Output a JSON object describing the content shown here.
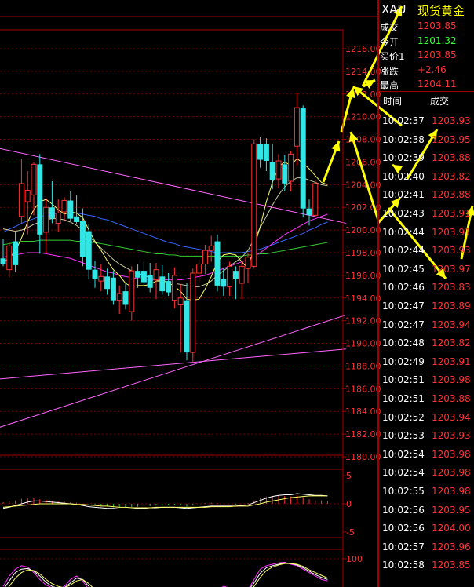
{
  "header": {
    "symbol": "XAU",
    "name": "现货黄金"
  },
  "quote": [
    {
      "label": "成交",
      "value": "1203.85",
      "color": "#ff3333"
    },
    {
      "label": "今开",
      "value": "1201.32",
      "color": "#33ff33"
    },
    {
      "label": "买价1",
      "value": "1203.85",
      "color": "#ff3333"
    },
    {
      "label": "涨跌",
      "value": "+2.46",
      "color": "#ff3333"
    },
    {
      "label": "最高",
      "value": "1204.11",
      "color": "#ff3333"
    }
  ],
  "ticks_header": {
    "time": "时间",
    "price": "成交"
  },
  "ticks": [
    {
      "time": "10:02:37",
      "price": "1203.93"
    },
    {
      "time": "10:02:38",
      "price": "1203.95"
    },
    {
      "time": "10:02:39",
      "price": "1203.88"
    },
    {
      "time": "10:02:40",
      "price": "1203.82"
    },
    {
      "time": "10:02:41",
      "price": "1203.88"
    },
    {
      "time": "10:02:43",
      "price": "1203.91"
    },
    {
      "time": "10:02:44",
      "price": "1203.91"
    },
    {
      "time": "10:02:44",
      "price": "1203.93"
    },
    {
      "time": "10:02:45",
      "price": "1203.97"
    },
    {
      "time": "10:02:46",
      "price": "1203.83"
    },
    {
      "time": "10:02:47",
      "price": "1203.89"
    },
    {
      "time": "10:02:47",
      "price": "1203.94"
    },
    {
      "time": "10:02:48",
      "price": "1203.82"
    },
    {
      "time": "10:02:49",
      "price": "1203.91"
    },
    {
      "time": "10:02:51",
      "price": "1203.98"
    },
    {
      "time": "10:02:51",
      "price": "1203.88"
    },
    {
      "time": "10:02:52",
      "price": "1203.94"
    },
    {
      "time": "10:02:53",
      "price": "1203.93"
    },
    {
      "time": "10:02:54",
      "price": "1203.98"
    },
    {
      "time": "10:02:54",
      "price": "1203.98"
    },
    {
      "time": "10:02:55",
      "price": "1203.98"
    },
    {
      "time": "10:02:56",
      "price": "1203.95"
    },
    {
      "time": "10:02:56",
      "price": "1204.00"
    },
    {
      "time": "10:02:57",
      "price": "1203.96"
    },
    {
      "time": "10:02:58",
      "price": "1203.85"
    }
  ],
  "colors": {
    "up": "#ff3333",
    "down": "#33e6e6",
    "grid": "#7a0000",
    "frame": "#a00000",
    "axis_text": "#ff3333",
    "trendline": "#ff66ff",
    "ma5": "#ffff66",
    "ma10": "#c8c8a0",
    "ma20": "#ff33ff",
    "ma60": "#3366ff",
    "ma120": "#33cc33",
    "arrow": "#ffff00"
  },
  "chart_data": [
    {
      "type": "candlestick",
      "title": "",
      "ylim": [
        1180,
        1218
      ],
      "yticks": [
        "1216.00",
        "1214.00",
        "1212.00",
        "1210.00",
        "1208.00",
        "1206.00",
        "1204.00",
        "1202.00",
        "1200.00",
        "1198.00",
        "1196.00",
        "1194.00",
        "1192.00",
        "1190.00",
        "1188.00",
        "1186.00",
        "1184.00",
        "1182.00",
        "1180.00"
      ],
      "candles": [
        {
          "o": 1197.5,
          "h": 1199.2,
          "l": 1196.8,
          "c": 1197.0
        },
        {
          "o": 1196.5,
          "h": 1198.9,
          "l": 1195.8,
          "c": 1198.6
        },
        {
          "o": 1199.0,
          "h": 1199.9,
          "l": 1196.3,
          "c": 1196.9
        },
        {
          "o": 1201.2,
          "h": 1206.3,
          "l": 1200.6,
          "c": 1204.1
        },
        {
          "o": 1202.5,
          "h": 1205.2,
          "l": 1199.6,
          "c": 1203.5
        },
        {
          "o": 1203.1,
          "h": 1206.0,
          "l": 1201.3,
          "c": 1205.8
        },
        {
          "o": 1205.8,
          "h": 1206.7,
          "l": 1197.9,
          "c": 1199.6
        },
        {
          "o": 1199.8,
          "h": 1202.8,
          "l": 1198.0,
          "c": 1202.0
        },
        {
          "o": 1202.0,
          "h": 1204.3,
          "l": 1200.6,
          "c": 1201.0
        },
        {
          "o": 1200.6,
          "h": 1202.7,
          "l": 1199.8,
          "c": 1201.5
        },
        {
          "o": 1201.6,
          "h": 1202.9,
          "l": 1200.8,
          "c": 1202.6
        },
        {
          "o": 1202.6,
          "h": 1203.4,
          "l": 1200.8,
          "c": 1201.0
        },
        {
          "o": 1201.2,
          "h": 1203.1,
          "l": 1200.5,
          "c": 1200.7
        },
        {
          "o": 1200.8,
          "h": 1201.9,
          "l": 1196.8,
          "c": 1197.6
        },
        {
          "o": 1199.9,
          "h": 1200.5,
          "l": 1195.7,
          "c": 1196.5
        },
        {
          "o": 1196.5,
          "h": 1197.3,
          "l": 1194.9,
          "c": 1195.7
        },
        {
          "o": 1195.5,
          "h": 1197.0,
          "l": 1194.6,
          "c": 1195.9
        },
        {
          "o": 1195.9,
          "h": 1196.6,
          "l": 1194.3,
          "c": 1194.8
        },
        {
          "o": 1195.8,
          "h": 1196.4,
          "l": 1193.4,
          "c": 1193.8
        },
        {
          "o": 1193.8,
          "h": 1195.1,
          "l": 1192.6,
          "c": 1194.4
        },
        {
          "o": 1194.6,
          "h": 1195.3,
          "l": 1193.0,
          "c": 1193.4
        },
        {
          "o": 1192.8,
          "h": 1196.8,
          "l": 1192.0,
          "c": 1196.4
        },
        {
          "o": 1196.4,
          "h": 1197.0,
          "l": 1194.9,
          "c": 1195.8
        },
        {
          "o": 1196.4,
          "h": 1197.2,
          "l": 1195.0,
          "c": 1195.4
        },
        {
          "o": 1196.0,
          "h": 1197.1,
          "l": 1194.5,
          "c": 1194.9
        },
        {
          "o": 1195.6,
          "h": 1197.1,
          "l": 1193.9,
          "c": 1196.5
        },
        {
          "o": 1195.9,
          "h": 1196.9,
          "l": 1194.3,
          "c": 1194.6
        },
        {
          "o": 1195.5,
          "h": 1196.2,
          "l": 1194.2,
          "c": 1194.5
        },
        {
          "o": 1193.8,
          "h": 1196.7,
          "l": 1193.1,
          "c": 1196.0
        },
        {
          "o": 1193.4,
          "h": 1195.2,
          "l": 1189.2,
          "c": 1194.0
        },
        {
          "o": 1193.8,
          "h": 1195.3,
          "l": 1188.5,
          "c": 1189.2
        },
        {
          "o": 1189.2,
          "h": 1196.6,
          "l": 1188.3,
          "c": 1196.2
        },
        {
          "o": 1196.2,
          "h": 1197.4,
          "l": 1195.3,
          "c": 1197.0
        },
        {
          "o": 1197.0,
          "h": 1198.7,
          "l": 1196.1,
          "c": 1198.2
        },
        {
          "o": 1198.2,
          "h": 1199.5,
          "l": 1197.2,
          "c": 1198.6
        },
        {
          "o": 1199.0,
          "h": 1199.6,
          "l": 1194.6,
          "c": 1195.1
        },
        {
          "o": 1195.7,
          "h": 1196.7,
          "l": 1194.2,
          "c": 1195.0
        },
        {
          "o": 1195.0,
          "h": 1197.2,
          "l": 1194.2,
          "c": 1196.8
        },
        {
          "o": 1196.4,
          "h": 1196.8,
          "l": 1193.9,
          "c": 1195.7
        },
        {
          "o": 1195.3,
          "h": 1197.2,
          "l": 1193.9,
          "c": 1196.8
        },
        {
          "o": 1196.6,
          "h": 1198.0,
          "l": 1195.3,
          "c": 1197.6
        },
        {
          "o": 1196.8,
          "h": 1208.0,
          "l": 1196.6,
          "c": 1207.6
        },
        {
          "o": 1207.6,
          "h": 1208.2,
          "l": 1205.5,
          "c": 1206.2
        },
        {
          "o": 1207.6,
          "h": 1208.1,
          "l": 1205.2,
          "c": 1206.1
        },
        {
          "o": 1206.0,
          "h": 1207.6,
          "l": 1203.6,
          "c": 1204.4
        },
        {
          "o": 1204.5,
          "h": 1206.7,
          "l": 1203.7,
          "c": 1206.1
        },
        {
          "o": 1205.8,
          "h": 1206.6,
          "l": 1203.4,
          "c": 1204.1
        },
        {
          "o": 1204.3,
          "h": 1207.0,
          "l": 1203.4,
          "c": 1206.7
        },
        {
          "o": 1207.4,
          "h": 1212.1,
          "l": 1205.7,
          "c": 1210.8
        },
        {
          "o": 1210.8,
          "h": 1211.0,
          "l": 1201.1,
          "c": 1201.9
        },
        {
          "o": 1201.9,
          "h": 1202.7,
          "l": 1200.4,
          "c": 1201.3
        },
        {
          "o": 1201.3,
          "h": 1204.4,
          "l": 1201.1,
          "c": 1204.1
        }
      ],
      "ma5": [
        1197.0,
        1197.6,
        1198.1,
        1199.3,
        1200.7,
        1201.8,
        1202.5,
        1202.7,
        1202.3,
        1201.8,
        1201.4,
        1201.6,
        1201.5,
        1201.1,
        1200.0,
        1199.0,
        1198.2,
        1197.3,
        1196.5,
        1196.0,
        1195.3,
        1195.0,
        1195.1,
        1195.1,
        1195.2,
        1195.5,
        1195.5,
        1195.4,
        1195.0,
        1194.6,
        1193.9,
        1193.8,
        1193.9,
        1194.8,
        1195.9,
        1197.2,
        1197.8,
        1197.9,
        1197.8,
        1197.2,
        1196.6,
        1198.5,
        1200.3,
        1202.5,
        1204.2,
        1205.6,
        1206.0,
        1205.7,
        1206.3,
        1205.9,
        1205.4,
        1204.8,
        1204.2,
        1204.0
      ],
      "ma10": [
        1200.1,
        1200.0,
        1199.9,
        1200.0,
        1200.2,
        1200.5,
        1200.7,
        1200.9,
        1201.0,
        1201.0,
        1200.9,
        1200.7,
        1200.4,
        1200.0,
        1199.5,
        1198.9,
        1198.4,
        1197.9,
        1197.4,
        1197.0,
        1196.7,
        1196.4,
        1196.2,
        1196.0,
        1195.8,
        1195.6,
        1195.5,
        1195.4,
        1195.3,
        1195.2,
        1195.1,
        1195.0,
        1195.0,
        1195.2,
        1195.5,
        1196.0,
        1196.4,
        1196.8,
        1197.2,
        1197.6,
        1198.2,
        1199.2,
        1200.2,
        1201.2,
        1202.2,
        1203.1,
        1203.8,
        1204.3,
        1204.6,
        1204.6,
        1204.4,
        1204.2,
        1204.0,
        1203.9
      ],
      "ma20": [
        1197.6,
        1197.7,
        1197.8,
        1197.9,
        1198.0,
        1198.0,
        1198.0,
        1197.9,
        1197.8,
        1197.7,
        1197.6,
        1197.5,
        1197.3,
        1197.1,
        1196.9,
        1196.7,
        1196.5,
        1196.3,
        1196.2,
        1196.0,
        1195.9,
        1195.8,
        1195.7,
        1195.7,
        1195.6,
        1195.6,
        1195.6,
        1195.6,
        1195.6,
        1195.6,
        1195.7,
        1195.8,
        1195.9,
        1196.0,
        1196.2,
        1196.4,
        1196.6,
        1196.8,
        1197.0,
        1197.2,
        1197.4,
        1197.7,
        1198.0,
        1198.4,
        1198.8,
        1199.2,
        1199.6,
        1199.9,
        1200.2,
        1200.5,
        1200.8,
        1201.0,
        1201.2,
        1201.4
      ],
      "ma60": [
        1199.8,
        1200.1,
        1200.3,
        1200.6,
        1200.8,
        1201.0,
        1201.2,
        1201.3,
        1201.4,
        1201.5,
        1201.5,
        1201.5,
        1201.5,
        1201.4,
        1201.3,
        1201.2,
        1201.0,
        1200.9,
        1200.7,
        1200.5,
        1200.3,
        1200.1,
        1199.9,
        1199.7,
        1199.5,
        1199.3,
        1199.1,
        1198.9,
        1198.8,
        1198.6,
        1198.5,
        1198.4,
        1198.3,
        1198.2,
        1198.1,
        1198.0,
        1198.0,
        1198.0,
        1198.0,
        1198.0,
        1198.1,
        1198.2,
        1198.3,
        1198.5,
        1198.7,
        1198.9,
        1199.1,
        1199.3,
        1199.5,
        1199.7,
        1200.0,
        1200.2,
        1200.5,
        1200.7
      ],
      "ma120": [
        1198.7,
        1198.8,
        1198.9,
        1199.0,
        1199.0,
        1199.0,
        1199.1,
        1199.1,
        1199.1,
        1199.1,
        1199.1,
        1199.1,
        1199.0,
        1199.0,
        1198.9,
        1198.9,
        1198.8,
        1198.7,
        1198.6,
        1198.5,
        1198.4,
        1198.3,
        1198.2,
        1198.1,
        1198.0,
        1197.9,
        1197.9,
        1197.8,
        1197.8,
        1197.7,
        1197.7,
        1197.7,
        1197.7,
        1197.7,
        1197.7,
        1197.7,
        1197.7,
        1197.7,
        1197.7,
        1197.7,
        1197.8,
        1197.8,
        1197.9,
        1197.9,
        1198.0,
        1198.1,
        1198.2,
        1198.3,
        1198.4,
        1198.5,
        1198.6,
        1198.7,
        1198.8,
        1198.9
      ],
      "trendlines": [
        {
          "x1": -4,
          "y1": 1207.6,
          "x2": 56,
          "y2": 1200.6
        },
        {
          "x1": -4,
          "y1": 1182.0,
          "x2": 56,
          "y2": 1192.5
        },
        {
          "x1": -4,
          "y1": 1186.7,
          "x2": 56,
          "y2": 1189.5
        }
      ]
    },
    {
      "type": "bar",
      "title": "",
      "ylim": [
        -5,
        5
      ],
      "yticks": [
        "5",
        "0",
        "-5"
      ],
      "values": [
        0.3,
        0.5,
        0.6,
        0.9,
        1.0,
        1.1,
        0.8,
        0.7,
        0.5,
        0.4,
        0.4,
        0.3,
        0.2,
        0.0,
        -0.2,
        -0.3,
        -0.4,
        -0.5,
        -0.6,
        -0.6,
        -0.7,
        -0.6,
        -0.5,
        -0.5,
        -0.4,
        -0.3,
        -0.3,
        -0.3,
        -0.2,
        -0.3,
        -0.5,
        -0.3,
        -0.1,
        0.1,
        0.2,
        0.1,
        0.0,
        0.0,
        -0.1,
        0.0,
        0.1,
        0.6,
        1.0,
        1.3,
        1.4,
        1.5,
        1.4,
        1.3,
        1.5,
        1.2,
        0.8,
        0.6,
        0.6,
        0.5
      ],
      "line_a": [
        -0.8,
        -0.6,
        -0.3,
        0.0,
        0.3,
        0.5,
        0.5,
        0.4,
        0.3,
        0.2,
        0.1,
        0.0,
        -0.1,
        -0.3,
        -0.5,
        -0.6,
        -0.7,
        -0.8,
        -0.8,
        -0.9,
        -0.9,
        -0.9,
        -0.8,
        -0.8,
        -0.7,
        -0.7,
        -0.6,
        -0.6,
        -0.6,
        -0.7,
        -0.8,
        -0.7,
        -0.6,
        -0.5,
        -0.4,
        -0.4,
        -0.4,
        -0.4,
        -0.4,
        -0.3,
        -0.2,
        0.2,
        0.6,
        1.0,
        1.3,
        1.5,
        1.6,
        1.6,
        1.8,
        1.7,
        1.6,
        1.5,
        1.5,
        1.4
      ],
      "line_b": [
        -0.6,
        -0.5,
        -0.4,
        -0.3,
        -0.2,
        -0.1,
        0.0,
        0.0,
        0.0,
        0.0,
        0.0,
        0.0,
        -0.1,
        -0.1,
        -0.2,
        -0.3,
        -0.4,
        -0.4,
        -0.5,
        -0.6,
        -0.6,
        -0.7,
        -0.7,
        -0.7,
        -0.7,
        -0.6,
        -0.6,
        -0.6,
        -0.6,
        -0.6,
        -0.6,
        -0.6,
        -0.6,
        -0.6,
        -0.5,
        -0.5,
        -0.5,
        -0.5,
        -0.4,
        -0.4,
        -0.4,
        -0.2,
        0.0,
        0.3,
        0.5,
        0.7,
        0.9,
        1.1,
        1.2,
        1.3,
        1.4,
        1.4,
        1.4,
        1.4
      ]
    },
    {
      "type": "line",
      "title": "",
      "ylim": [
        0,
        100
      ],
      "yticks": [
        "100"
      ],
      "series": [
        {
          "values": [
            60,
            75,
            85,
            90,
            88,
            80,
            70,
            62,
            58,
            55,
            60,
            70,
            75,
            68,
            55,
            45,
            40,
            38,
            35,
            30,
            30,
            32,
            35,
            38,
            40,
            42,
            40,
            38,
            40,
            42,
            35,
            25,
            22,
            30,
            45,
            55,
            60,
            58,
            55,
            50,
            55,
            70,
            85,
            90,
            92,
            94,
            95,
            92,
            90,
            85,
            80,
            75,
            70,
            68
          ],
          "color": "#ff33ff"
        },
        {
          "values": [
            55,
            68,
            80,
            85,
            86,
            82,
            75,
            66,
            60,
            57,
            58,
            65,
            72,
            70,
            60,
            50,
            44,
            40,
            37,
            33,
            31,
            31,
            33,
            36,
            38,
            40,
            40,
            39,
            39,
            41,
            37,
            29,
            24,
            27,
            38,
            50,
            57,
            58,
            56,
            52,
            54,
            65,
            79,
            87,
            90,
            92,
            94,
            93,
            91,
            87,
            82,
            77,
            73,
            70
          ],
          "color": "#ffffff"
        },
        {
          "values": [
            50,
            60,
            72,
            80,
            84,
            83,
            78,
            70,
            64,
            60,
            58,
            62,
            68,
            70,
            64,
            55,
            48,
            43,
            39,
            35,
            32,
            31,
            32,
            34,
            36,
            38,
            39,
            39,
            39,
            40,
            38,
            32,
            27,
            27,
            33,
            44,
            52,
            56,
            56,
            53,
            53,
            60,
            73,
            83,
            88,
            91,
            93,
            93,
            92,
            89,
            84,
            80,
            76,
            72
          ],
          "color": "#ffff66"
        }
      ]
    }
  ]
}
